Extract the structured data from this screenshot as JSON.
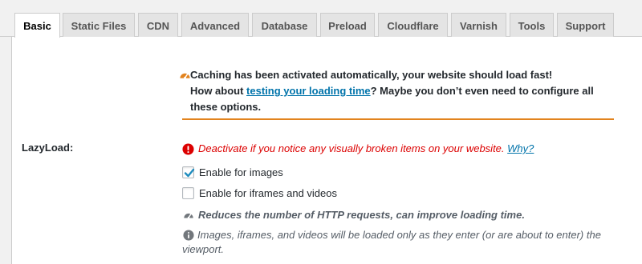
{
  "tabs": [
    {
      "label": "Basic",
      "active": true
    },
    {
      "label": "Static Files"
    },
    {
      "label": "CDN"
    },
    {
      "label": "Advanced"
    },
    {
      "label": "Database"
    },
    {
      "label": "Preload"
    },
    {
      "label": "Cloudflare"
    },
    {
      "label": "Varnish"
    },
    {
      "label": "Tools"
    },
    {
      "label": "Support"
    }
  ],
  "notice": {
    "line1": "Caching has been activated automatically, your website should load fast!",
    "line2_prefix": "How about ",
    "line2_link": "testing your loading time",
    "line2_suffix": "? Maybe you don’t even need to configure all",
    "line3": "these options.",
    "accent_color": "#e2831e"
  },
  "lazyload": {
    "label": "LazyLoad:",
    "warning_text": "Deactivate if you notice any visually broken items on your website.",
    "warning_link": "Why?",
    "warning_color": "#dc0000",
    "options": [
      {
        "label": "Enable for images",
        "checked": true
      },
      {
        "label": "Enable for iframes and videos",
        "checked": false
      }
    ],
    "benefit_text": "Reduces the number of HTTP requests, can improve loading time.",
    "info_text": "Images, iframes, and videos will be loaded only as they enter (or are about to enter) the viewport."
  },
  "colors": {
    "link": "#0073aa",
    "check": "#1e8cbe"
  }
}
